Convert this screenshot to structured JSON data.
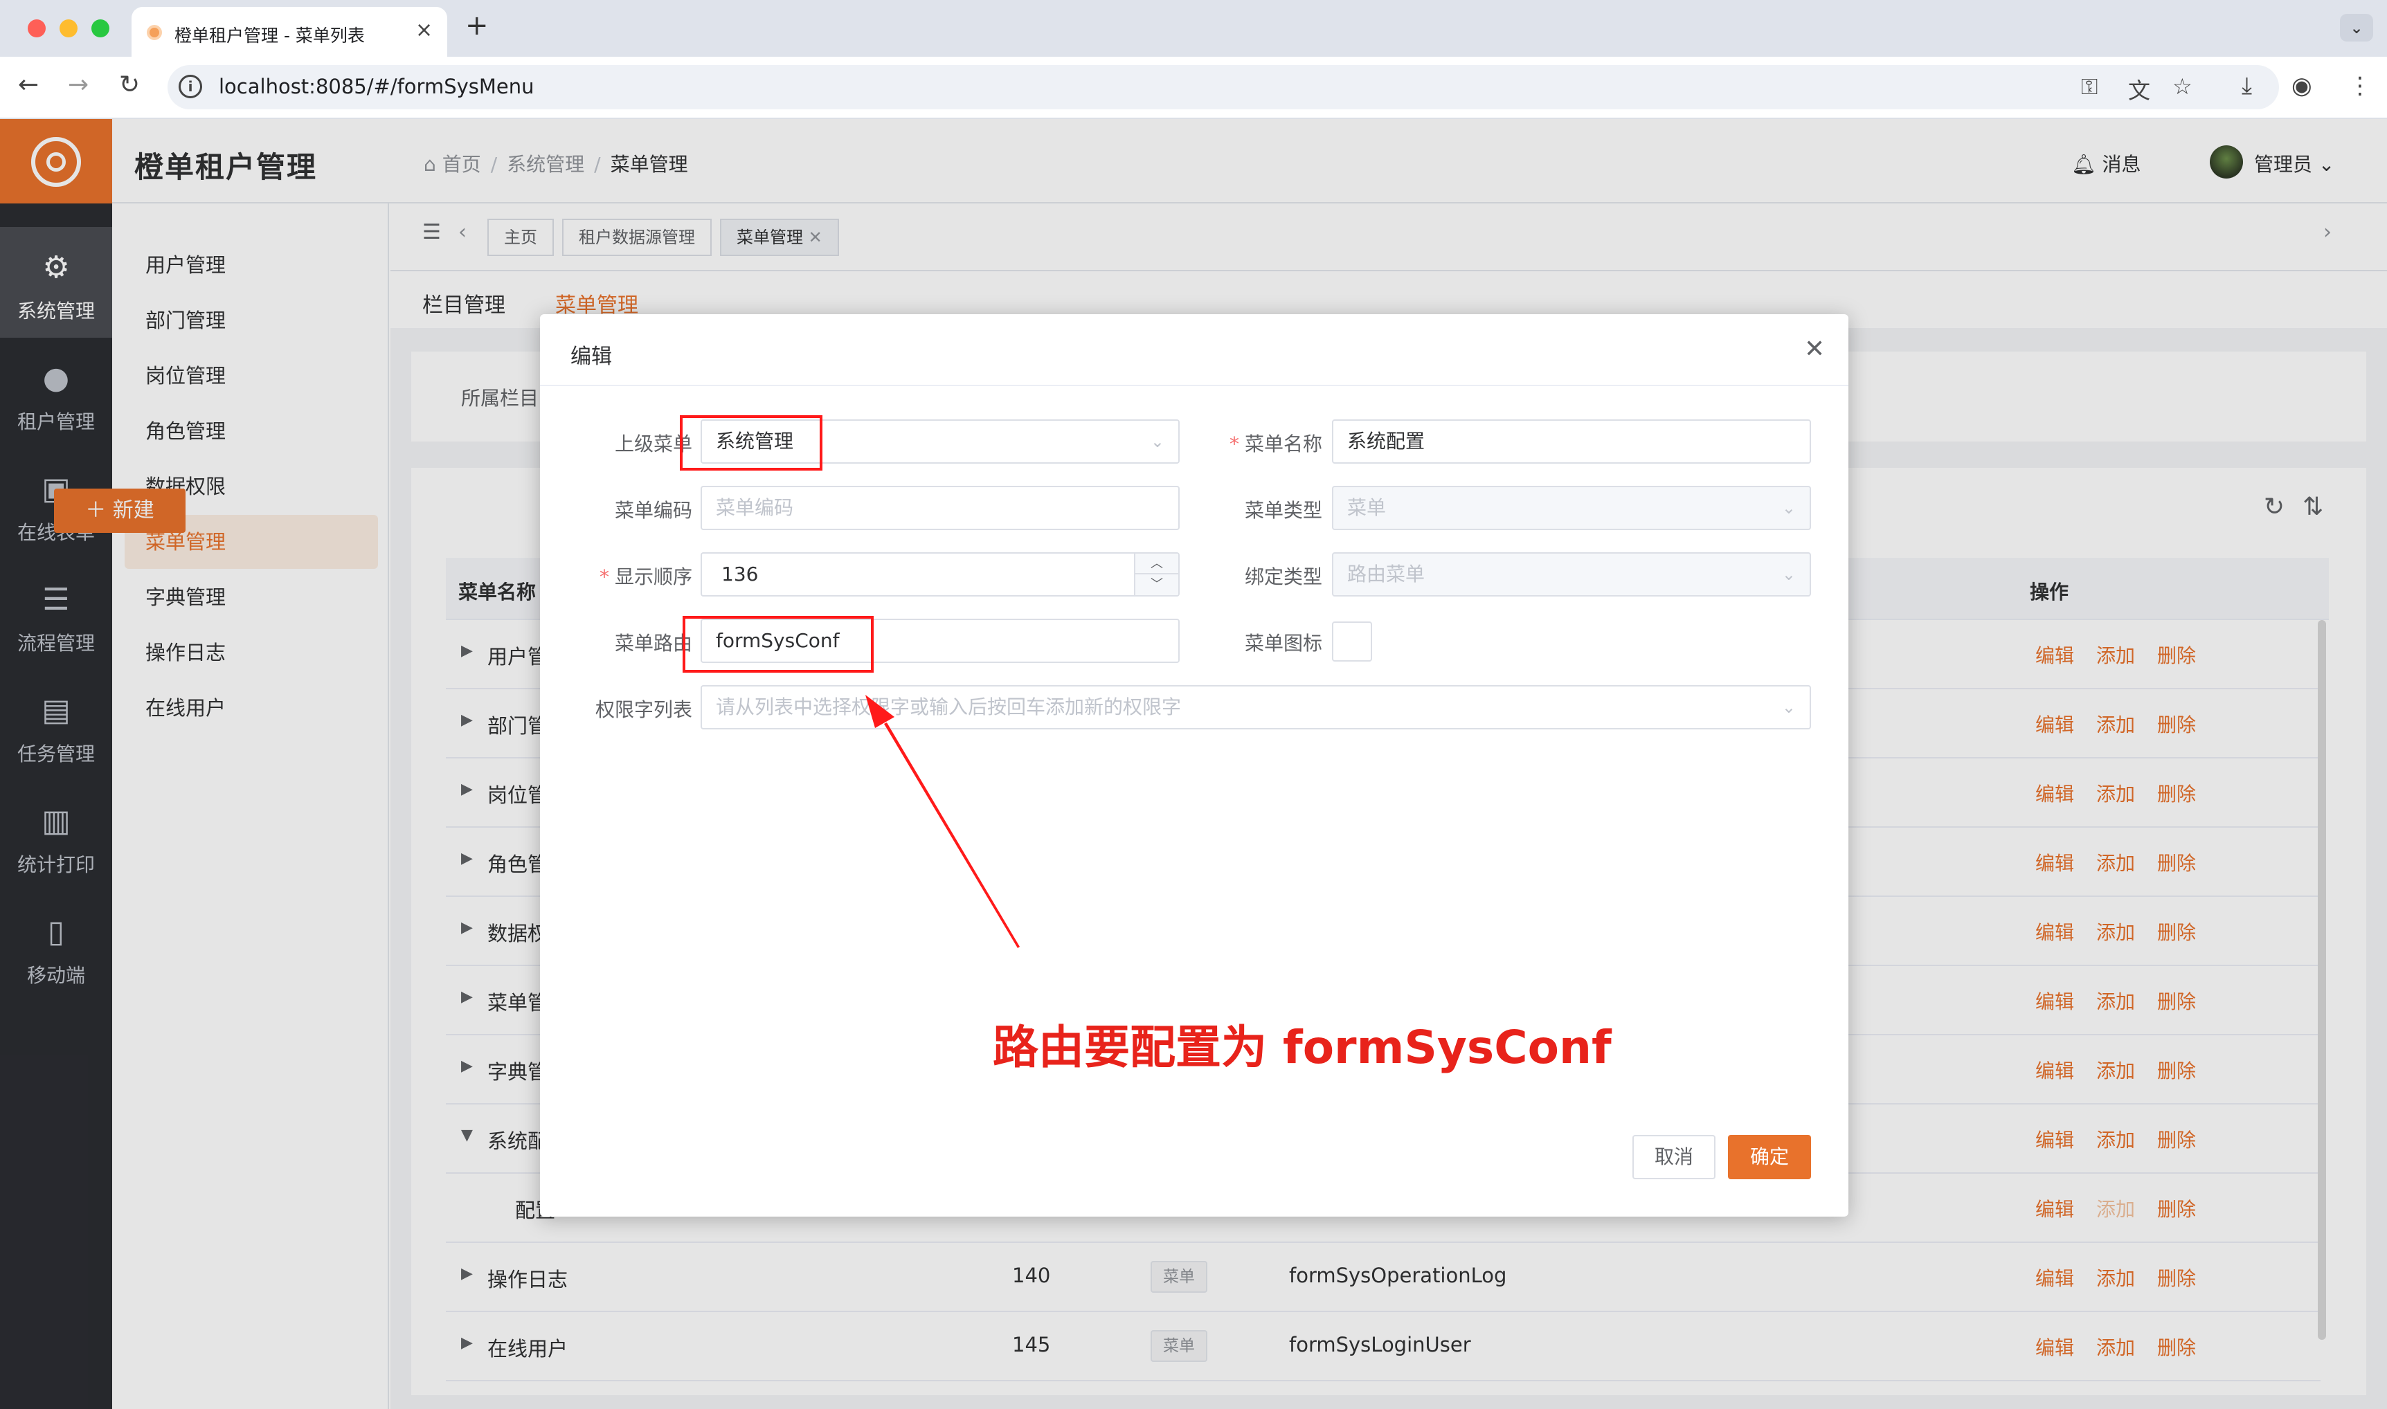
{
  "browser": {
    "tab_title": "橙单租户管理 - 菜单列表",
    "url": "localhost:8085/#/formSysMenu",
    "new_tab": "+",
    "tab_close": "×",
    "tab_menu": "⌄"
  },
  "app": {
    "title": "橙单租户管理",
    "breadcrumb": [
      "首页",
      "系统管理",
      "菜单管理"
    ],
    "messages_label": "消息",
    "user_label": "管理员"
  },
  "sidebar": [
    {
      "label": "系统管理",
      "icon": "gear-icon"
    },
    {
      "label": "租户管理",
      "icon": "user-icon"
    },
    {
      "label": "在线表单",
      "icon": "form-icon"
    },
    {
      "label": "流程管理",
      "icon": "sliders-icon"
    },
    {
      "label": "任务管理",
      "icon": "task-icon"
    },
    {
      "label": "统计打印",
      "icon": "chart-icon"
    },
    {
      "label": "移动端",
      "icon": "mobile-icon"
    }
  ],
  "submenu": [
    "用户管理",
    "部门管理",
    "岗位管理",
    "角色管理",
    "数据权限",
    "菜单管理",
    "字典管理",
    "操作日志",
    "在线用户"
  ],
  "tags": [
    "主页",
    "租户数据源管理",
    "菜单管理"
  ],
  "page_tabs": [
    "栏目管理",
    "菜单管理"
  ],
  "filter_label": "所属栏目",
  "new_button": "新建",
  "table": {
    "headers": {
      "name": "菜单名称",
      "ops": "操作"
    },
    "ops": {
      "edit": "编辑",
      "add": "添加",
      "delete": "删除"
    },
    "rows": [
      {
        "name": "用户管",
        "order": "",
        "type": "",
        "route": ""
      },
      {
        "name": "部门管",
        "order": "",
        "type": "",
        "route": ""
      },
      {
        "name": "岗位管",
        "order": "",
        "type": "",
        "route": ""
      },
      {
        "name": "角色管",
        "order": "",
        "type": "",
        "route": ""
      },
      {
        "name": "数据权",
        "order": "",
        "type": "",
        "route": ""
      },
      {
        "name": "菜单管",
        "order": "",
        "type": "",
        "route": ""
      },
      {
        "name": "字典管",
        "order": "",
        "type": "",
        "route": ""
      },
      {
        "name": "系统配",
        "order": "",
        "type": "",
        "route": ""
      },
      {
        "name": "配置",
        "order": "",
        "type": "",
        "route": ""
      },
      {
        "name": "操作日志",
        "order": "140",
        "type": "菜单",
        "route": "formSysOperationLog"
      },
      {
        "name": "在线用户",
        "order": "145",
        "type": "菜单",
        "route": "formSysLoginUser"
      }
    ]
  },
  "dialog": {
    "title": "编辑",
    "parent_menu_label": "上级菜单",
    "parent_menu_value": "系统管理",
    "menu_name_label": "菜单名称",
    "menu_name_value": "系统配置",
    "menu_code_label": "菜单编码",
    "menu_code_placeholder": "菜单编码",
    "menu_type_label": "菜单类型",
    "menu_type_value": "菜单",
    "order_label": "显示顺序",
    "order_value": "136",
    "bind_type_label": "绑定类型",
    "bind_type_value": "路由菜单",
    "route_label": "菜单路由",
    "route_value": "formSysConf",
    "icon_label": "菜单图标",
    "perm_label": "权限字列表",
    "perm_placeholder": "请从列表中选择权限字或输入后按回车添加新的权限字",
    "cancel": "取消",
    "confirm": "确定"
  },
  "annotation": "路由要配置为 formSysConf",
  "colors": {
    "accent": "#e8722c",
    "highlight": "#ff1a1a",
    "sidebar": "#2b2d32"
  }
}
